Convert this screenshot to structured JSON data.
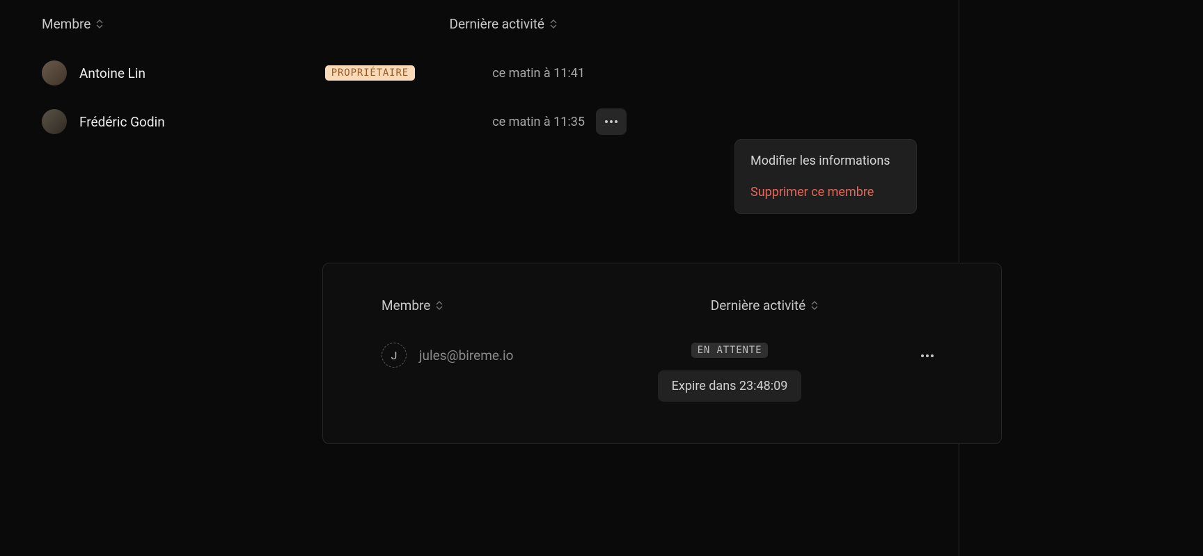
{
  "mainTable": {
    "headers": {
      "member": "Membre",
      "activity": "Dernière activité"
    },
    "rows": [
      {
        "name": "Antoine Lin",
        "ownerBadge": "PROPRIÉTAIRE",
        "activity": "ce matin à 11:41",
        "hasMenu": false
      },
      {
        "name": "Frédéric Godin",
        "ownerBadge": null,
        "activity": "ce matin à 11:35",
        "hasMenu": true
      }
    ],
    "menu": {
      "edit": "Modifier les informations",
      "remove": "Supprimer ce membre"
    }
  },
  "pendingCard": {
    "headers": {
      "member": "Membre",
      "activity": "Dernière activité"
    },
    "row": {
      "avatarInitial": "J",
      "email": "jules@bireme.io",
      "statusBadge": "EN ATTENTE",
      "expireText": "Expire dans 23:48:09"
    }
  }
}
